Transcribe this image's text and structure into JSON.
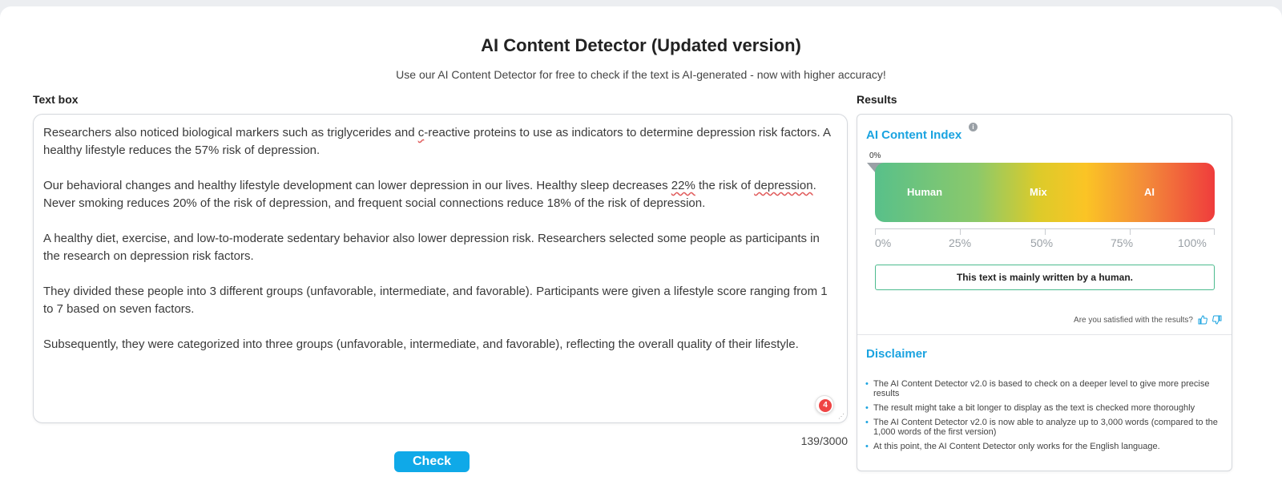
{
  "header": {
    "title": "AI Content Detector (Updated version)",
    "subtitle": "Use our AI Content Detector for free to check if the text is AI-generated - now with higher accuracy!"
  },
  "textbox": {
    "label": "Text box",
    "paragraphs": [
      {
        "a": "Researchers also noticed biological markers such as triglycerides and ",
        "b": "c",
        "c": "-reactive proteins to use as indicators to determine depression risk factors. A healthy lifestyle reduces the 57% risk of depression."
      },
      {
        "a": "Our behavioral changes and healthy lifestyle development can lower depression in our lives. Healthy sleep decreases ",
        "b": "22%",
        "c": " the risk of ",
        "d": "depression",
        "e": ". Never smoking reduces 20% of the risk of depression, and frequent social connections reduce 18% of the risk of depression."
      },
      {
        "a": "A healthy diet, exercise, and low-to-moderate sedentary behavior also lower depression risk. Researchers selected some people as participants in the research on depression risk factors."
      },
      {
        "a": " They divided these people into 3 different groups (unfavorable, intermediate, and favorable). Participants were given a lifestyle score ranging from 1 to 7 based on seven factors."
      },
      {
        "a": "Subsequently, they were categorized into three groups (unfavorable, intermediate, and favorable), reflecting the overall quality of their lifestyle."
      }
    ],
    "grammar_issues": "4",
    "word_count": "139/3000"
  },
  "actions": {
    "check_label": "Check"
  },
  "results": {
    "label": "Results",
    "index_title": "AI Content Index",
    "info_icon": "i",
    "pointer_value": "0%",
    "ai_index_fraction": 0,
    "gauge_labels": [
      "Human",
      "Mix",
      "AI"
    ],
    "scale_labels": [
      "0%",
      "25%",
      "50%",
      "75%",
      "100%"
    ],
    "verdict": "This text is mainly written by a human.",
    "feedback_question": "Are you satisfied with the results?",
    "feedback_icons": [
      "thumbs-up-icon",
      "thumbs-down-icon"
    ],
    "accent_color": "#1aa3e0"
  },
  "disclaimer": {
    "title": "Disclaimer",
    "items": [
      "The AI Content Detector v2.0 is based to check on a deeper level to give more precise results",
      "The result might take a bit longer to display as the text is checked more thoroughly",
      "The AI Content Detector v2.0 is now able to analyze up to 3,000 words (compared to the 1,000 words of the first version)",
      "At this point, the AI Content Detector only works for the English language."
    ]
  }
}
